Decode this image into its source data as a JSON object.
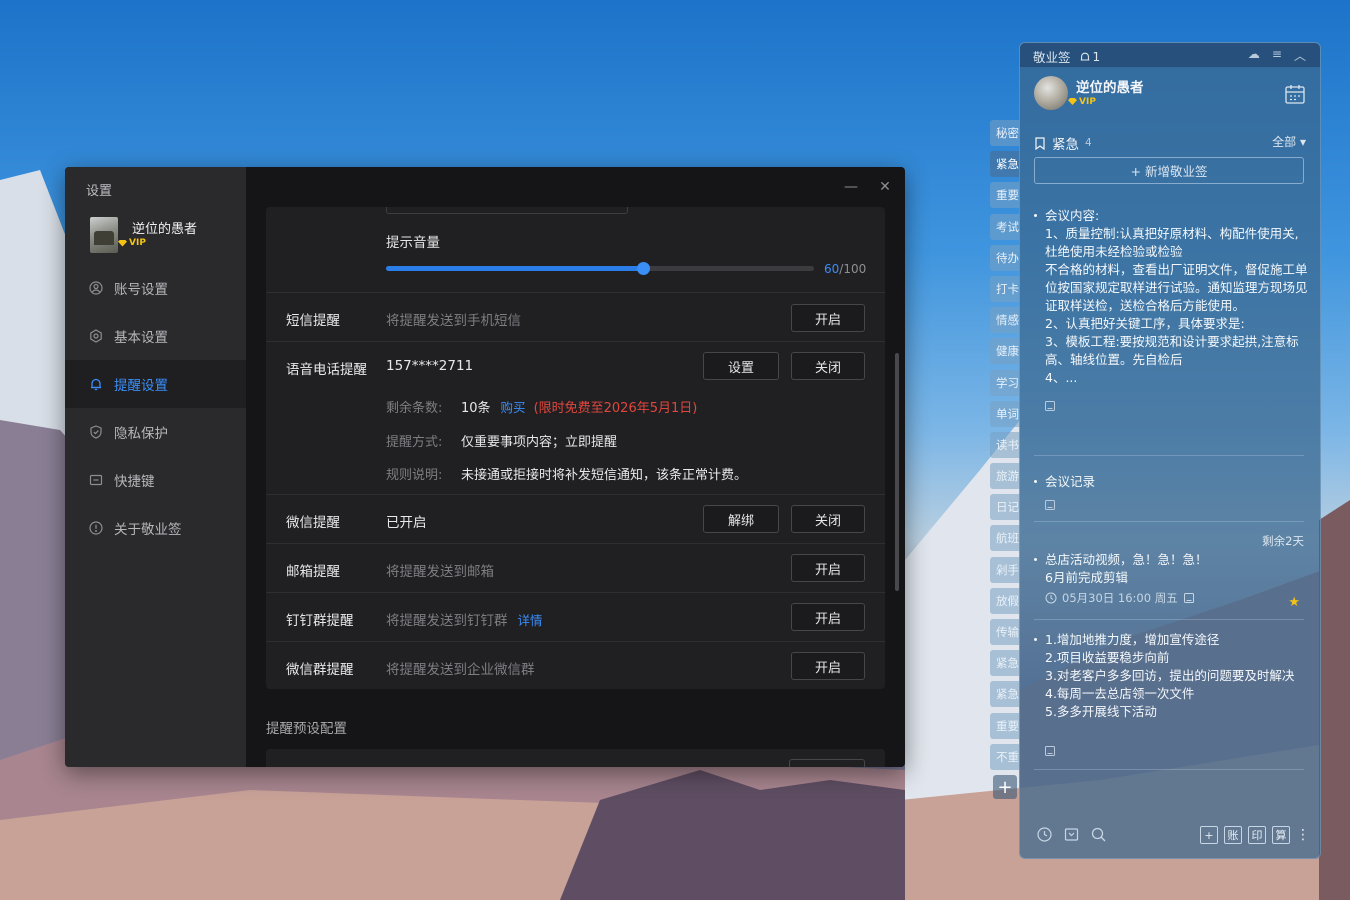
{
  "settings": {
    "window_title": "设置",
    "user": {
      "name": "逆位的愚者",
      "vip": "VIP"
    },
    "nav": [
      {
        "label": "账号设置",
        "icon": "user-circle-icon",
        "active": false
      },
      {
        "label": "基本设置",
        "icon": "gear-icon",
        "active": false
      },
      {
        "label": "提醒设置",
        "icon": "bell-icon",
        "active": true
      },
      {
        "label": "隐私保护",
        "icon": "shield-icon",
        "active": false
      },
      {
        "label": "快捷键",
        "icon": "keyboard-icon",
        "active": false
      },
      {
        "label": "关于敬业签",
        "icon": "info-icon",
        "active": false
      }
    ],
    "volume": {
      "label": "提示音量",
      "value": 60,
      "max": 100,
      "max_label": "/100"
    },
    "sms": {
      "label": "短信提醒",
      "desc": "将提醒发送到手机短信",
      "button": "开启"
    },
    "voice": {
      "label": "语音电话提醒",
      "phone": "157****2711",
      "settings_button": "设置",
      "toggle_button": "关闭",
      "remaining_key": "剩余条数:",
      "remaining_value": "10条",
      "buy_link": "购买",
      "free_note": "(限时免费至2026年5月1日)",
      "method_key": "提醒方式:",
      "method_value": "仅重要事项内容；立即提醒",
      "rule_key": "规则说明:",
      "rule_value": "未接通或拒接时将补发短信通知，该条正常计费。"
    },
    "wechat": {
      "label": "微信提醒",
      "status": "已开启",
      "unbind_button": "解绑",
      "toggle_button": "关闭"
    },
    "email": {
      "label": "邮箱提醒",
      "desc": "将提醒发送到邮箱",
      "button": "开启"
    },
    "dingtalk": {
      "label": "钉钉群提醒",
      "desc": "将提醒发送到钉钉群",
      "link": "详情",
      "button": "开启"
    },
    "wecom": {
      "label": "微信群提醒",
      "desc": "将提醒发送到企业微信群",
      "button": "开启"
    },
    "preset_title": "提醒预设配置"
  },
  "widget": {
    "app_name": "敬业签",
    "notif_count": "1",
    "user": {
      "name": "逆位的愚者",
      "vip": "VIP"
    },
    "category": {
      "name": "紧急",
      "count": "4"
    },
    "filter": "全部",
    "add_button": "+ 新增敬业签",
    "tabs": [
      "秘密",
      "紧急",
      "重要",
      "考试",
      "待办",
      "打卡",
      "情感",
      "健康",
      "学习",
      "单词",
      "读书",
      "旅游",
      "日记",
      "航班",
      "剁手",
      "放假",
      "传输",
      "紧急",
      "紧急",
      "重要",
      "不重"
    ],
    "notes": [
      {
        "title": "会议内容:",
        "lines": [
          "1、质量控制:认真把好原材料、构配件使用关,杜绝使用未经检验或检验",
          "不合格的材料，查看出厂证明文件，督促施工单位按国家规定取样进行试验。通知监理方现场见证取样送检，送检合格后方能使用。",
          "2、认真把好关键工序，具体要求是:",
          "3、模板工程:要按规范和设计要求起拱,注意标高、轴线位置。先自检后",
          "4、..."
        ]
      },
      {
        "title": "会议记录"
      },
      {
        "remaining": "剩余2天",
        "title": "总店活动视频，急！急！急！",
        "lines": [
          "6月前完成剪辑"
        ],
        "meta": "05月30日 16:00 周五"
      },
      {
        "lines": [
          "1.增加地推力度，增加宣传途径",
          "2.项目收益要稳步向前",
          "3.对老客户多多回访，提出的问题要及时解决",
          "4.每周一去总店领一次文件",
          "5.多多开展线下活动"
        ]
      }
    ],
    "bottom_right": [
      "+",
      "账",
      "印",
      "算"
    ]
  }
}
